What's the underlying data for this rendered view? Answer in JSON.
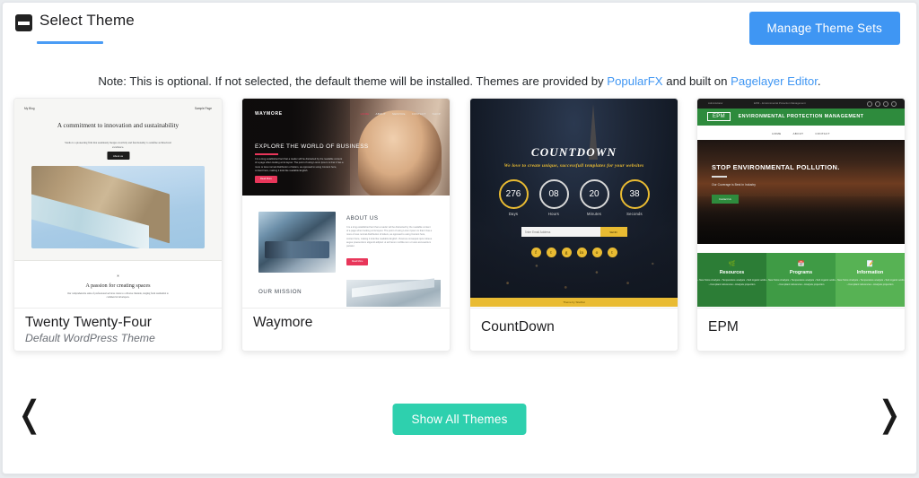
{
  "header": {
    "title": "Select Theme",
    "collapse_icon": "collapse-icon",
    "manage_button": "Manage Theme Sets",
    "accent_blue": "#3f96f3"
  },
  "note": {
    "prefix": "Note: This is optional. If not selected, the default theme will be installed. Themes are provided by ",
    "link1": "PopularFX",
    "middle": " and built on ",
    "link2": "Pagelayer Editor",
    "suffix": "."
  },
  "themes": [
    {
      "name": "Twenty Twenty-Four",
      "subtitle": "Default WordPress Theme",
      "preview": {
        "nav_left": "My Blog",
        "nav_right": "Sample Page",
        "heading": "A commitment to innovation and sustainability",
        "paragraph": "Studio is a pioneering firm that seamlessly merges creativity and functionality to redefine architectural excellence.",
        "button": "About us",
        "divider_mark": "✳",
        "heading2": "A passion for creating spaces",
        "paragraph2": "Our comprehensive suite of professional services caters to a diverse clientele, ranging from residential to commercial developers."
      }
    },
    {
      "name": "Waymore",
      "subtitle": "",
      "preview": {
        "logo": "WAYMORE",
        "nav": [
          "HOME",
          "ABOUT",
          "SERVICE",
          "CONTACT",
          "SHOP"
        ],
        "hero_heading": "EXPLORE THE WORLD OF BUSINESS",
        "hero_paragraph": "It is a long established fact that a reader will be distracted by the readable content of a page when looking at its layout. The point of using Lorem Ipsum is that it has a more or less normal distribution of letters, as opposed to using Content here, content here, making it look like readable English.",
        "hero_button": "Read More",
        "about_heading": "ABOUT US",
        "about_paragraph": "It is a long established fact that a reader will be distracted by the readable content of a page when looking at its layout. The point of using Lorem Ipsum is that it has a more or less normal distribution of letters, as opposed to using Content here, content here, making it look like readable English. Vivamus consequat quis nobeus augue praesentium eligendi adipisci ut ad harum mollitia rem ut iusto accusantium pariatur.",
        "about_button": "Read More",
        "mission_heading": "OUR MISSION"
      }
    },
    {
      "name": "CountDown",
      "subtitle": "",
      "preview": {
        "title": "COUNTDOWN",
        "tagline": "We love to create unique, successfull templates for your websites",
        "counters": [
          {
            "value": "276",
            "label": "Days",
            "accent": true
          },
          {
            "value": "08",
            "label": "Hours",
            "accent": false
          },
          {
            "value": "20",
            "label": "Minutes",
            "accent": false
          },
          {
            "value": "38",
            "label": "Seconds",
            "accent": true
          }
        ],
        "email_placeholder": "Enter Email Address",
        "send_button": "SEND",
        "socials": [
          "f",
          "t",
          "g",
          "in",
          "o",
          "t"
        ],
        "footer": "Theme by SiteFlat",
        "accent_yellow": "#e9bb32"
      }
    },
    {
      "name": "EPM",
      "subtitle": "",
      "preview": {
        "browser_tab": "Administrator",
        "browser_url": "EPM – Environmental Protection Management",
        "logo": "EPM",
        "bar_title": "ENVIRONMENTAL PROTECTION MANAGEMENT",
        "nav": [
          "HOME",
          "ABOUT",
          "CONTACT"
        ],
        "hero_heading": "STOP ENVIRONMENTAL POLLUTION.",
        "hero_subtitle": "Our Coverage is Best in Industry",
        "hero_button": "Contact Us",
        "columns": [
          {
            "icon": "🌿",
            "heading": "Resources",
            "links": "› New Store Analysis\n› Temperature analysis\n› Soil organic acids\n› Compliant references\n› Analysis projection"
          },
          {
            "icon": "📅",
            "heading": "Programs",
            "links": "› New Store Analysis\n› Temperature analysis\n› Soil organic acids\n› Compliant references\n› Analysis projection"
          },
          {
            "icon": "📝",
            "heading": "Information",
            "links": "› New Store Analysis\n› Temperature analysis\n› Soil organic acids\n› Compliant references\n› Analysis projection"
          }
        ],
        "accent_green": "#2e8b3d"
      }
    }
  ],
  "footer": {
    "prev_arrow": "❬",
    "next_arrow": "❭",
    "show_all_button": "Show All Themes",
    "show_all_color": "#2ed0ae"
  }
}
